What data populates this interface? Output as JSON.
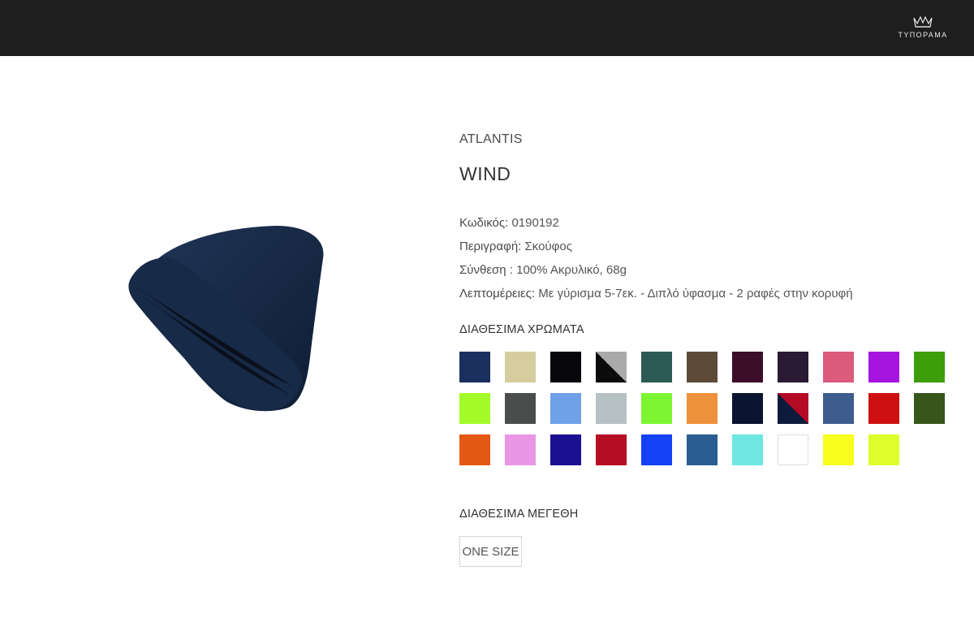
{
  "header": {
    "logo_text": "ΤΥΠΟΡΑΜΑ"
  },
  "product": {
    "brand": "ATLANTIS",
    "name": "WIND",
    "specs": [
      {
        "label": "Κωδικός:",
        "value": " 0190192"
      },
      {
        "label": "Περιγραφή:",
        "value": " Σκούφος"
      },
      {
        "label": "Σύνθεση :",
        "value": " 100% Ακρυλικό, 68g"
      },
      {
        "label": "Λεπτομέρειες:",
        "value": " Με γύρισμα 5-7εκ. - Διπλό ύφασμα - 2 ραφές στην κορυφή"
      }
    ]
  },
  "colors_heading": "ΔΙΑΘΕΣΙΜΑ ΧΡΩΜΑΤΑ",
  "colors": [
    [
      "#1b2f5e"
    ],
    [
      "#d6cd9f"
    ],
    [
      "#07070b"
    ],
    [
      "#0b0b0b",
      "#a9aaa9"
    ],
    [
      "#2c5b55"
    ],
    [
      "#5d4b38"
    ],
    [
      "#3d0e2a"
    ],
    [
      "#2a1a33"
    ],
    [
      "#dc5a7c"
    ],
    [
      "#a614e0"
    ],
    [
      "#3d9e0c"
    ],
    [
      "#a2fb28"
    ],
    [
      "#4a4d4c"
    ],
    [
      "#6ea1e7"
    ],
    [
      "#b5c1c2"
    ],
    [
      "#7ef532"
    ],
    [
      "#ed913b"
    ],
    [
      "#0a1431"
    ],
    [
      "#0d1a3b",
      "#b50a25"
    ],
    [
      "#3c5d8d"
    ],
    [
      "#cf1010"
    ],
    [
      "#37561a"
    ],
    [
      "#e55813"
    ],
    [
      "#e896e5"
    ],
    [
      "#1b1092"
    ],
    [
      "#b70d24"
    ],
    [
      "#1441f5"
    ],
    [
      "#2a5d91"
    ],
    [
      "#6de7e0"
    ],
    [
      "#ffffff"
    ],
    [
      "#f9fe1e"
    ],
    [
      "#defe2c"
    ]
  ],
  "sizes_heading": "ΔΙΑΘΕΣΙΜΑ ΜΕΓΕΘΗ",
  "sizes": [
    "ONE SIZE"
  ]
}
